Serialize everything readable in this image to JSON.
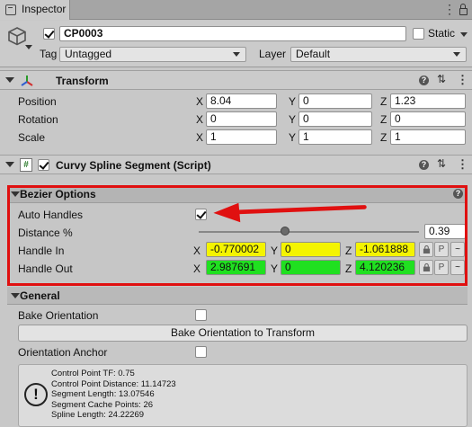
{
  "window": {
    "tab_label": "Inspector",
    "menu_glyph": "⋮"
  },
  "object": {
    "name": "CP0003",
    "static_label": "Static",
    "tag_label": "Tag",
    "tag_value": "Untagged",
    "layer_label": "Layer",
    "layer_value": "Default"
  },
  "transform": {
    "title": "Transform",
    "rows": [
      {
        "label": "Position",
        "x": "8.04",
        "y": "0",
        "z": "1.23"
      },
      {
        "label": "Rotation",
        "x": "0",
        "y": "0",
        "z": "0"
      },
      {
        "label": "Scale",
        "x": "1",
        "y": "1",
        "z": "1"
      }
    ],
    "axis_x": "X",
    "axis_y": "Y",
    "axis_z": "Z"
  },
  "component": {
    "title": "Curvy Spline Segment (Script)",
    "script_icon": "#",
    "bezier": {
      "title": "Bezier Options",
      "auto_handles_label": "Auto Handles",
      "distance_label": "Distance %",
      "distance_value": "0.39",
      "distance_fraction": 0.39,
      "handle_in": {
        "label": "Handle In",
        "x": "-0.770002",
        "y": "0",
        "z": "-1.061888",
        "color": "#f4f400"
      },
      "handle_out": {
        "label": "Handle Out",
        "x": "2.987691",
        "y": "0",
        "z": "4.120236",
        "color": "#20e020"
      },
      "p_label": "P",
      "tilde_label": "~"
    },
    "general": {
      "title": "General",
      "bake_label": "Bake Orientation",
      "bake_button": "Bake Orientation to Transform",
      "anchor_label": "Orientation Anchor"
    },
    "info": {
      "lines": [
        "Control Point TF: 0.75",
        "Control Point Distance: 11.14723",
        "Segment Length: 13.07546",
        "Segment Cache Points: 26",
        "Spline Length: 24.22269"
      ]
    }
  },
  "colors": {
    "highlight_box": "#e01010",
    "arrow": "#e01010"
  }
}
